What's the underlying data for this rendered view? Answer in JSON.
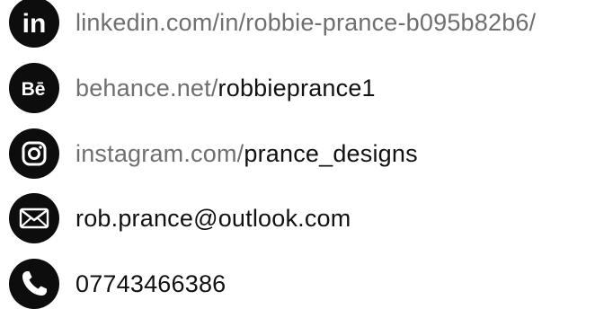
{
  "contacts": {
    "linkedin": {
      "icon": "linkedin-icon",
      "prefix": "linkedin.com/in/robbie-prance-b095b82b6/",
      "handle": ""
    },
    "behance": {
      "icon": "behance-icon",
      "prefix": "behance.net/",
      "handle": "robbieprance1"
    },
    "instagram": {
      "icon": "instagram-icon",
      "prefix": "instagram.com/",
      "handle": "prance_designs"
    },
    "email": {
      "icon": "mail-icon",
      "value": "rob.prance@outlook.com"
    },
    "phone": {
      "icon": "phone-icon",
      "value": "07743466386"
    }
  },
  "colors": {
    "icon_bg": "#0d0d0d",
    "muted_text": "#6f6f6f",
    "dark_text": "#111111"
  }
}
